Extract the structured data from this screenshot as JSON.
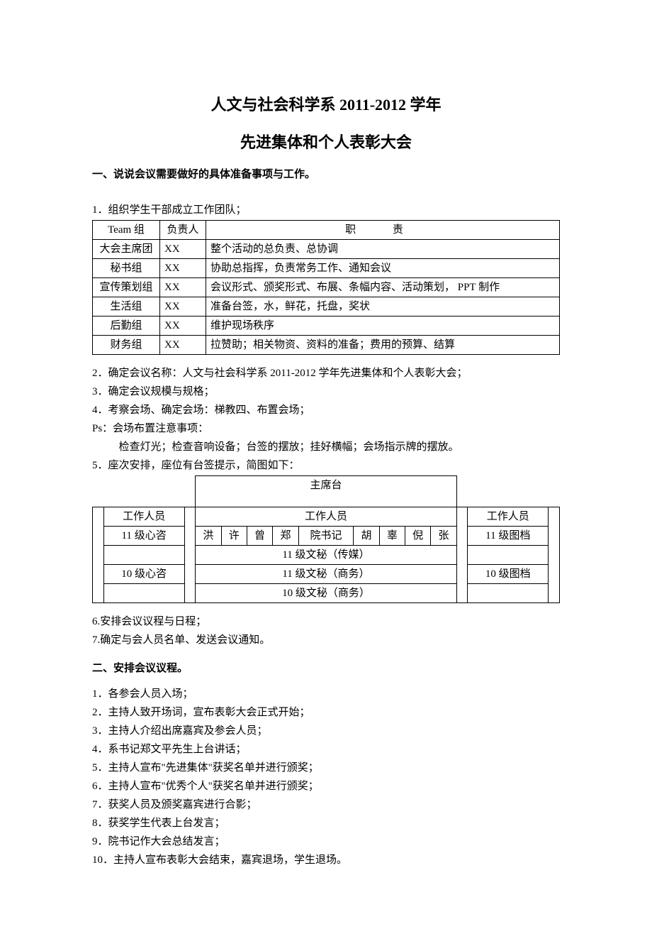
{
  "title_main": "人文与社会科学系 2011-2012 学年",
  "title_sub": "先进集体和个人表彰大会",
  "section1_heading": "一、说说会议需要做好的具体准备事项与工作。",
  "s1_item1": "1．组织学生干部成立工作团队；",
  "team_table": {
    "h_team": "Team 组",
    "h_person": "负责人",
    "h_duty": "职 责",
    "rows": [
      {
        "team": "大会主席团",
        "person": "XX",
        "duty": "整个活动的总负责、总协调"
      },
      {
        "team": "秘书组",
        "person": "XX",
        "duty": "协助总指挥，负责常务工作、通知会议"
      },
      {
        "team": "宣传策划组",
        "person": "XX",
        "duty": "会议形式、颁奖形式、布展、条幅内容、活动策划， PPT 制作"
      },
      {
        "team": "生活组",
        "person": "XX",
        "duty": "准备台签，水，鲜花，托盘，奖状"
      },
      {
        "team": "后勤组",
        "person": "XX",
        "duty": "维护现场秩序"
      },
      {
        "team": "财务组",
        "person": "XX",
        "duty": "拉赞助；相关物资、资料的准备；费用的预算、结算"
      }
    ]
  },
  "s1_item2": "2．确定会议名称：人文与社会科学系 2011-2012 学年先进集体和个人表彰大会；",
  "s1_item3": "3．确定会议规模与规格；",
  "s1_item4": "4．考察会场、确定会场：梯教四、布置会场；",
  "s1_ps": "Ps：会场布置注意事项：",
  "s1_ps_detail": "检查灯光；检查音响设备；台签的摆放；挂好横幅；会场指示牌的摆放。",
  "s1_item5": "5．座次安排，座位有台签提示，简图如下：",
  "seating": {
    "top": "主席台",
    "staff": "工作人员",
    "left1": "11 级心咨",
    "left2": "10 级心咨",
    "right1": "11 级图档",
    "right2": "10 级图档",
    "names": [
      "洪",
      "许",
      "曾",
      "郑",
      "院书记",
      "胡",
      "辜",
      "倪",
      "张"
    ],
    "mid1": "11 级文秘（传媒）",
    "mid2": "11 级文秘（商务）",
    "mid3": "10 级文秘（商务）"
  },
  "s1_item6": "6.安排会议议程与日程；",
  "s1_item7": "7.确定与会人员名单、发送会议通知。",
  "section2_heading": "二、安排会议议程。",
  "s2_items": [
    "1．各参会人员入场；",
    "2．主持人致开场词，宣布表彰大会正式开始；",
    "3．主持人介绍出席嘉宾及参会人员；",
    "4．系书记郑文平先生上台讲话；",
    "5．主持人宣布\"先进集体\"获奖名单并进行颁奖；",
    "6．主持人宣布\"优秀个人\"获奖名单并进行颁奖；",
    "7．获奖人员及颁奖嘉宾进行合影；",
    "8．获奖学生代表上台发言；",
    "9．院书记作大会总结发言；",
    "10．主持人宣布表彰大会结束，嘉宾退场，学生退场。"
  ]
}
